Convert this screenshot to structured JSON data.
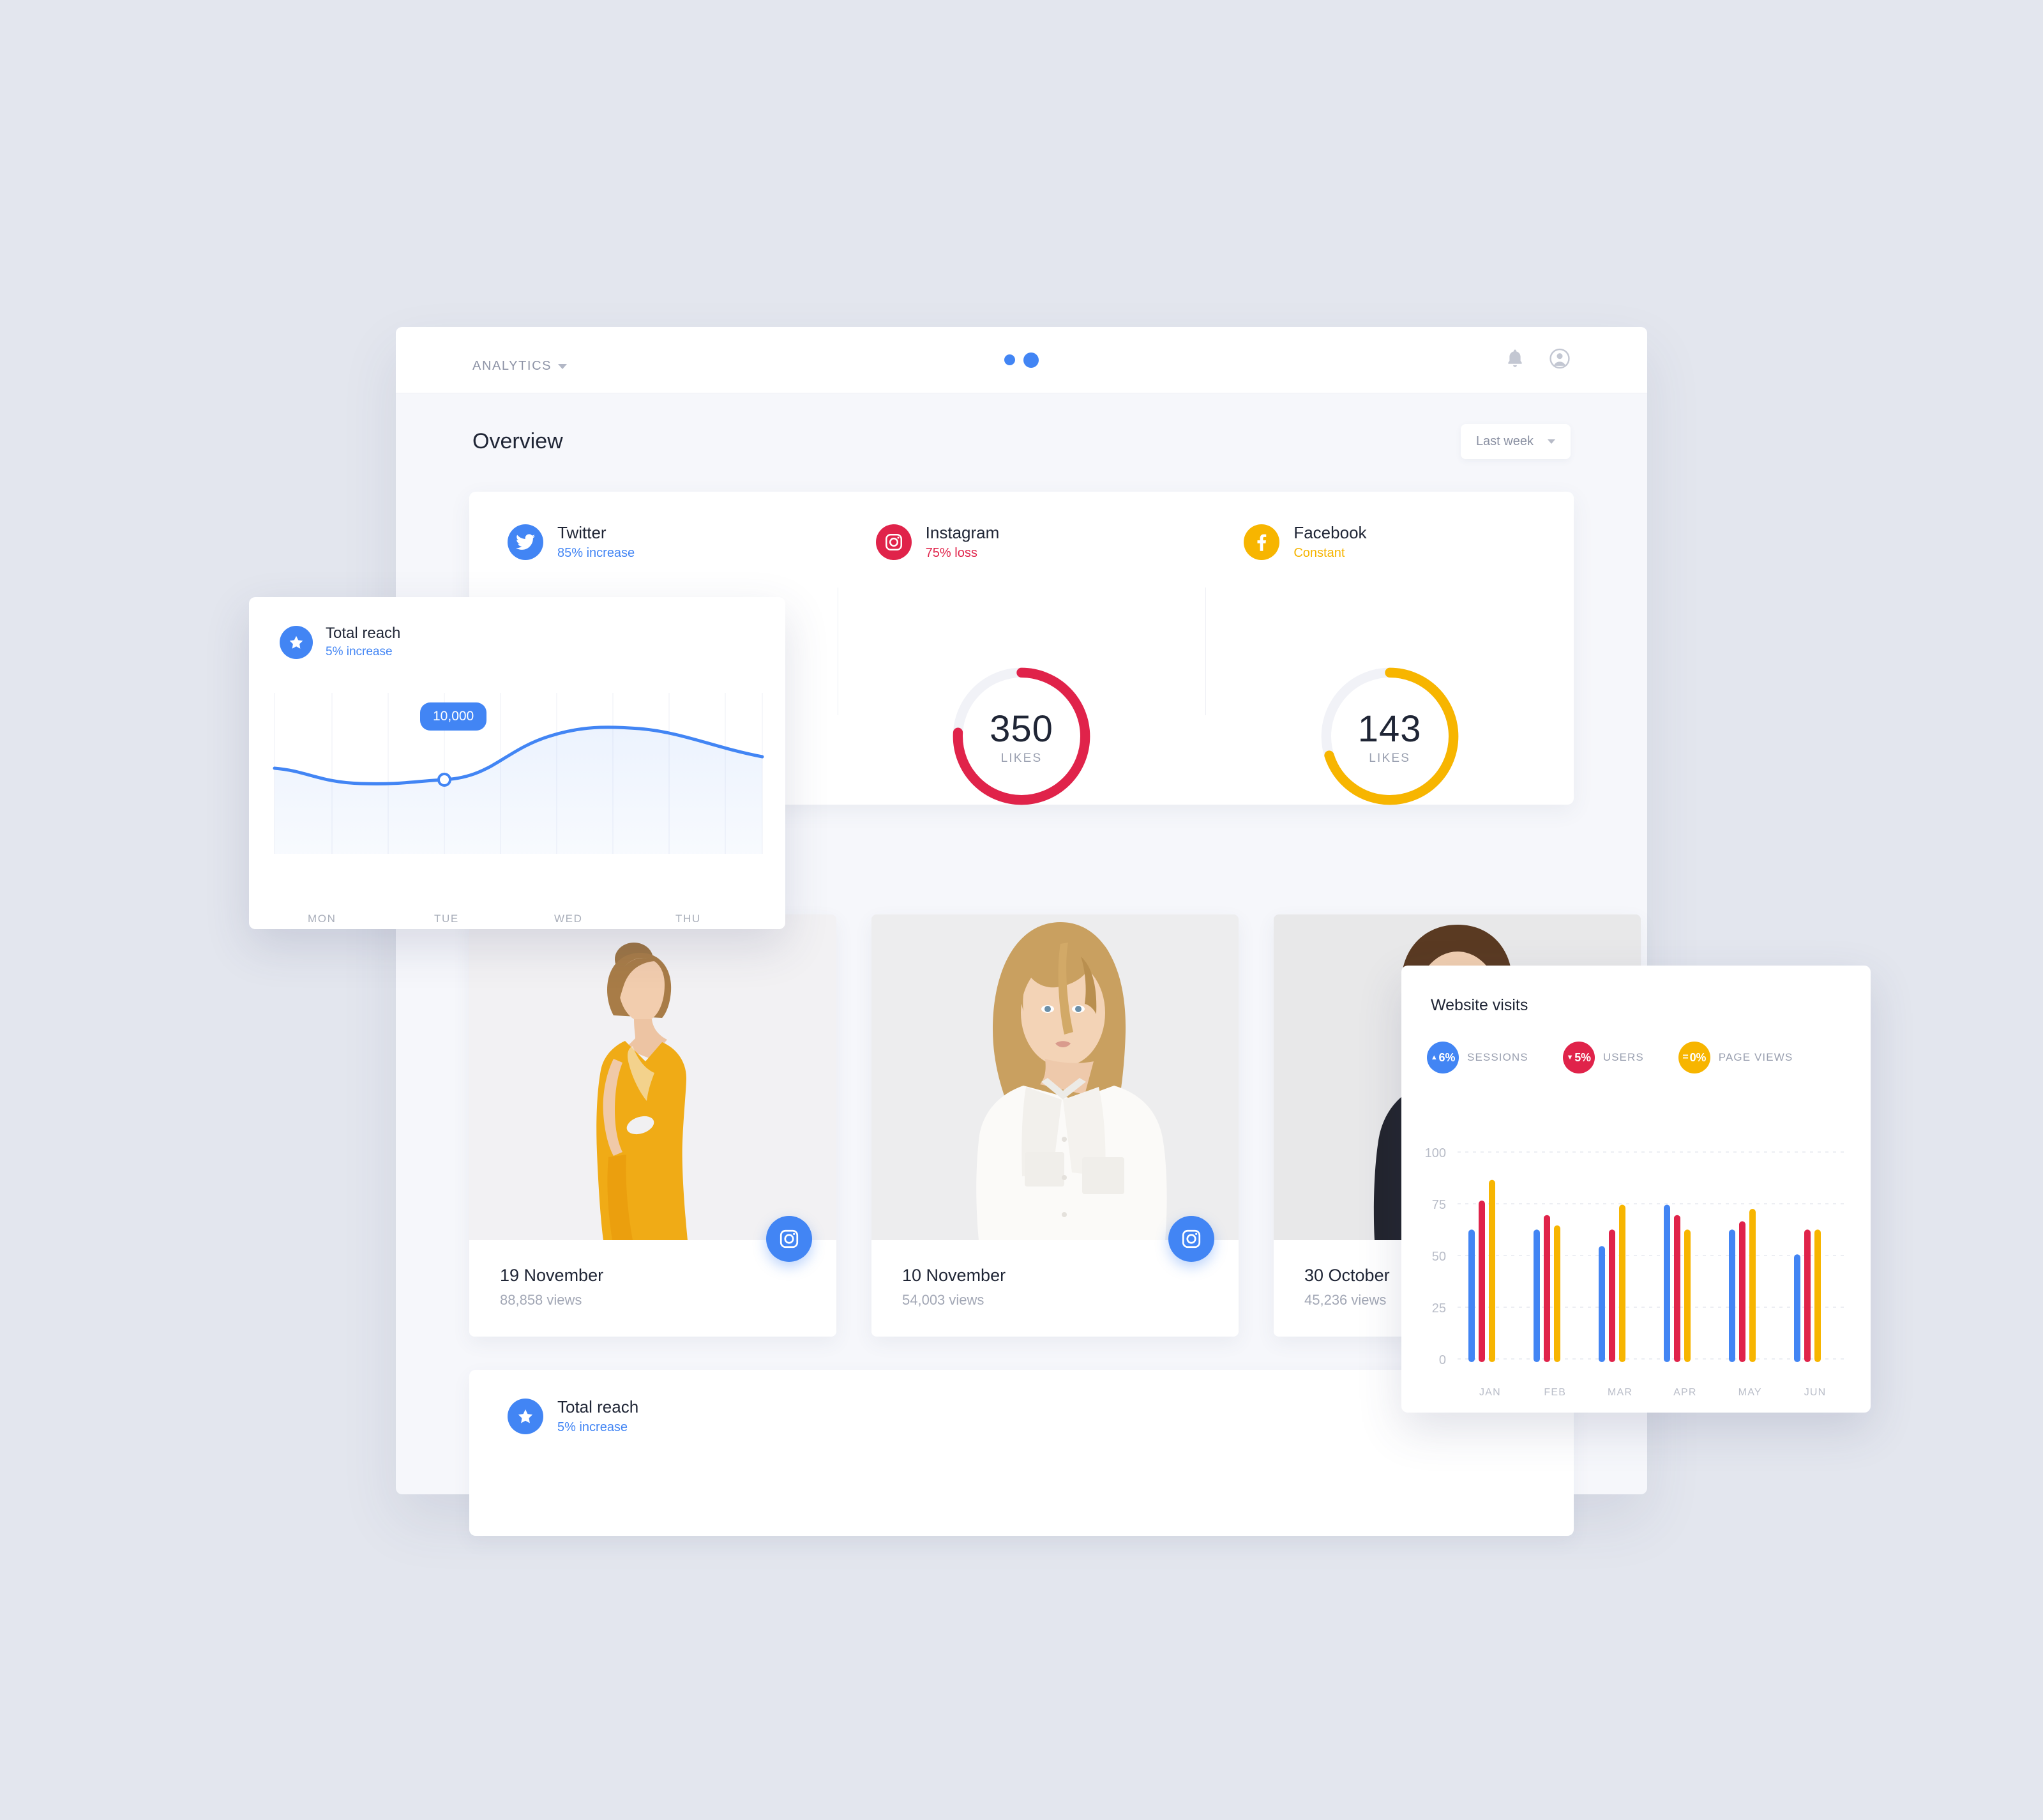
{
  "app": {
    "brand": "ANALYTICS",
    "dots": [
      "dot-small",
      "dot-large"
    ],
    "icons": [
      "bell-icon",
      "user-avatar-icon"
    ]
  },
  "overview": {
    "title": "Overview",
    "range_filter": "Last week",
    "channels": [
      {
        "id": "twitter",
        "name": "Twitter",
        "sub": "85% increase",
        "sub_tone": "blue",
        "color": "#4285f4",
        "icon": "twitter-icon",
        "donut": null
      },
      {
        "id": "instagram",
        "name": "Instagram",
        "sub": "75% loss",
        "sub_tone": "red",
        "color": "#e0234a",
        "icon": "instagram-icon",
        "donut": {
          "value": "350",
          "label": "LIKES",
          "percent": 76,
          "color": "#e0234a"
        }
      },
      {
        "id": "facebook",
        "name": "Facebook",
        "sub": "Constant",
        "sub_tone": "yellow",
        "color": "#f7b500",
        "icon": "facebook-icon",
        "donut": {
          "value": "143",
          "label": "LIKES",
          "percent": 70,
          "color": "#f7b500"
        }
      }
    ]
  },
  "posts": {
    "source_filter": "Instagram",
    "items": [
      {
        "date": "19 November",
        "views": "88,858 views",
        "badge_icon": "instagram-icon",
        "photo": "woman-yellow-dress"
      },
      {
        "date": "10 November",
        "views": "54,003 views",
        "badge_icon": "instagram-icon",
        "photo": "woman-white-shirt"
      },
      {
        "date": "30 October",
        "views": "45,236 views",
        "badge_icon": "instagram-icon",
        "photo": "man-black-jacket"
      }
    ]
  },
  "total_reach_bottom": {
    "name": "Total reach",
    "sub": "5% increase",
    "icon": "star-icon"
  },
  "total_reach_card": {
    "name": "Total reach",
    "sub": "5% increase",
    "icon": "star-icon",
    "tooltip": "10,000",
    "chart_data": {
      "type": "area",
      "title": "Total reach",
      "categories": [
        "MON",
        "TUE",
        "WED",
        "THU"
      ],
      "x": [
        0,
        1,
        2,
        3,
        4,
        5,
        6,
        7,
        8
      ],
      "series": [
        {
          "name": "Total reach",
          "values": [
            10800,
            10050,
            9900,
            10000,
            10900,
            13600,
            14900,
            14400,
            12700
          ],
          "color": "#4285f4"
        }
      ],
      "highlight": {
        "x_index": 3,
        "label": "10,000",
        "value": 10000
      },
      "xlabel": "",
      "ylabel": "",
      "grid": "vertical",
      "legend": "none"
    }
  },
  "website_visits": {
    "title": "Website visits",
    "legend": [
      {
        "delta": "6%",
        "arrow": "up",
        "label": "SESSIONS",
        "color": "#4285f4"
      },
      {
        "delta": "5%",
        "arrow": "down",
        "label": "USERS",
        "color": "#e0234a"
      },
      {
        "delta": "0%",
        "arrow": "flat",
        "label": "PAGE VIEWS",
        "color": "#f7b500"
      }
    ],
    "chart_data": {
      "type": "bar",
      "title": "Website visits",
      "categories": [
        "JAN",
        "FEB",
        "MAR",
        "APR",
        "MAY",
        "JUN"
      ],
      "series": [
        {
          "name": "SESSIONS",
          "color": "#4285f4",
          "values": [
            61,
            61,
            53,
            73,
            61,
            49
          ]
        },
        {
          "name": "USERS",
          "color": "#e0234a",
          "values": [
            75,
            68,
            61,
            68,
            65,
            61
          ]
        },
        {
          "name": "PAGE VIEWS",
          "color": "#f7b500",
          "values": [
            85,
            63,
            73,
            61,
            71,
            61
          ]
        }
      ],
      "yticks": [
        0,
        25,
        50,
        75,
        100
      ],
      "ylim": [
        0,
        100
      ],
      "xlabel": "",
      "ylabel": "",
      "grid": "horizontal-dashed",
      "legend": "top"
    }
  },
  "colors": {
    "background": "#e3e6ee",
    "panel": "#f6f7fb",
    "card": "#ffffff",
    "blue": "#4285f4",
    "red": "#e0234a",
    "yellow": "#f7b500",
    "text": "#1f2535",
    "muted": "#9aa0b0"
  }
}
